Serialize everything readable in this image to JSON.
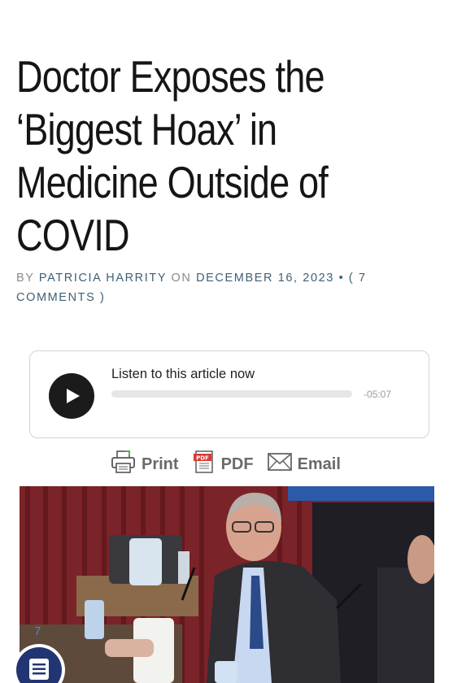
{
  "article": {
    "title_lines": [
      "Doctor Exposes the",
      "‘Biggest Hoax’ in",
      "Medicine Outside of",
      "COVID"
    ],
    "byline": {
      "by": "BY",
      "author": "PATRICIA HARRITY",
      "on": "ON",
      "date": "DECEMBER 16, 2023",
      "separator": "•",
      "comments_open": "(",
      "comments_count": "7",
      "comments_label": "COMMENTS",
      "comments_close": ")"
    }
  },
  "audio_player": {
    "title": "Listen to this article now",
    "time_remaining": "-05:07",
    "progress": 0
  },
  "share": {
    "print_label": "Print",
    "pdf_label": "PDF",
    "email_label": "Email",
    "pdf_badge": "PDF"
  },
  "image_overlay": {
    "number": "7"
  },
  "icons": {
    "play": "play-icon",
    "print": "printer-icon",
    "pdf": "pdf-document-icon",
    "email": "envelope-icon",
    "fab": "list-menu-icon"
  },
  "colors": {
    "link": "#3f5f75",
    "fab": "#223573",
    "player_button": "#1b1b1b"
  }
}
